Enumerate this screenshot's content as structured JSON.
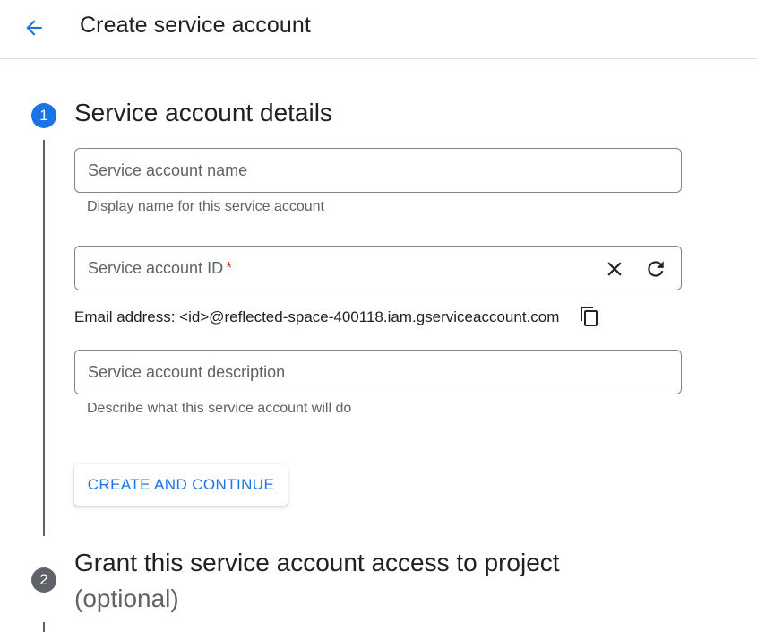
{
  "header": {
    "title": "Create service account"
  },
  "steps": [
    {
      "number": "1",
      "title": "Service account details"
    },
    {
      "number": "2",
      "title": "Grant this service account access to project",
      "subtitle": "(optional)"
    }
  ],
  "form": {
    "name_field": {
      "label": "Service account name",
      "value": "",
      "hint": "Display name for this service account"
    },
    "id_field": {
      "label": "Service account ID",
      "required_marker": "*",
      "value": ""
    },
    "email_text": "Email address: <id>@reflected-space-400118.iam.gserviceaccount.com",
    "description_field": {
      "label": "Service account description",
      "value": "",
      "hint": "Describe what this service account will do"
    },
    "submit_label": "CREATE AND CONTINUE"
  },
  "icons": {
    "back": "arrow-back-icon",
    "clear": "close-icon",
    "refresh": "refresh-icon",
    "copy": "copy-icon"
  },
  "colors": {
    "accent": "#1a73e8",
    "step_inactive": "#5f6368",
    "required": "#d93025",
    "border": "#80868b"
  }
}
